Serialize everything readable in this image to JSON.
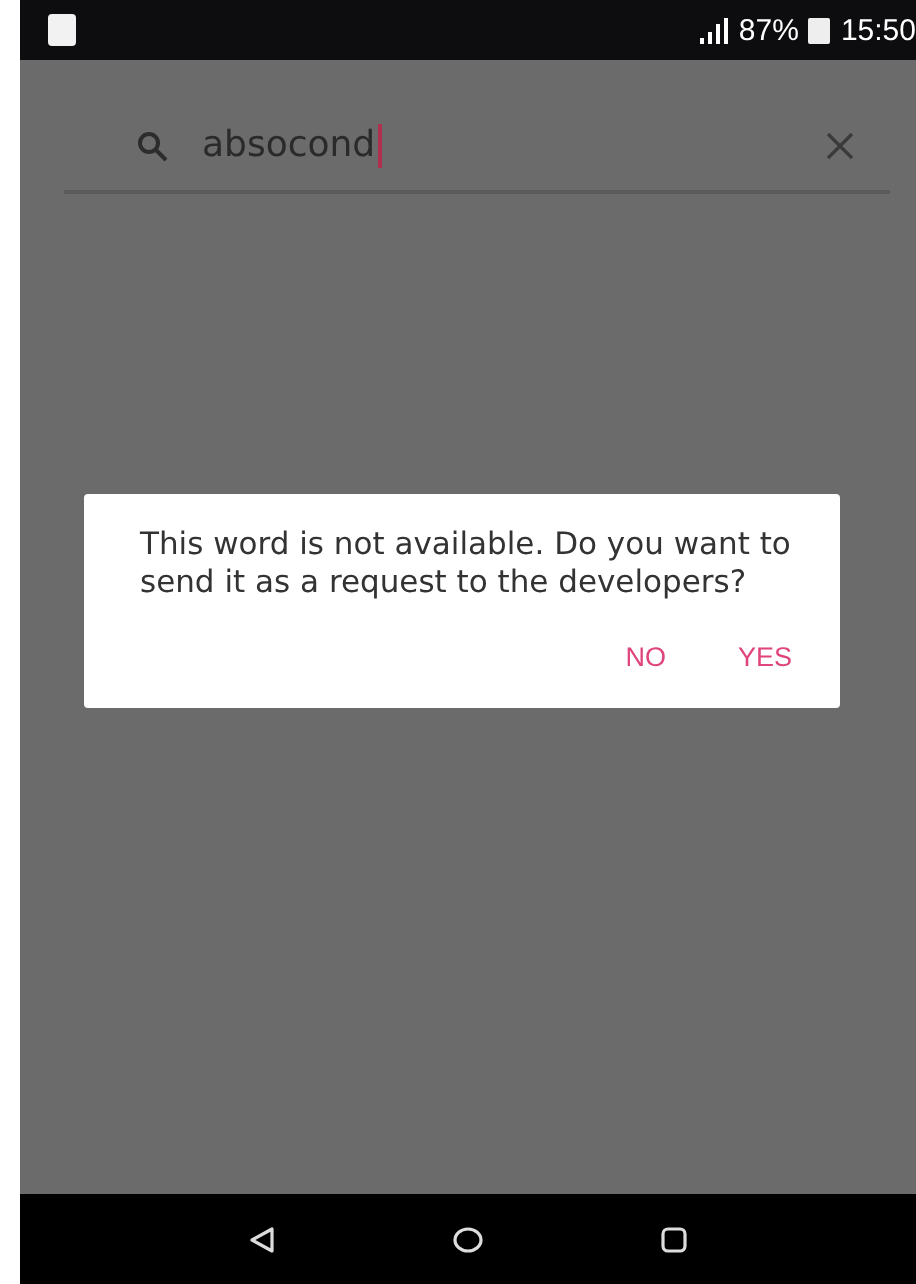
{
  "status_bar": {
    "battery": "87%",
    "time": "15:50"
  },
  "search": {
    "value": "absocond"
  },
  "dialog": {
    "message": "This word is not available. Do you want to send it as a request to the developers?",
    "buttons": [
      "NO",
      "YES"
    ]
  }
}
